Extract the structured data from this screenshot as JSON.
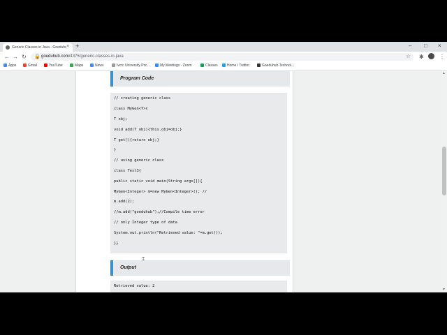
{
  "browser": {
    "tab_title": "Generic Classes in Java - Goeduhub",
    "new_tab": "+",
    "close_tab": "×",
    "window_controls": [
      "–",
      "□",
      "×"
    ],
    "url_host": "goeduhub.com",
    "url_path": "/4375/generic-classes-in-java",
    "bookmarks": [
      {
        "label": "Apps",
        "color": "#4285f4"
      },
      {
        "label": "Gmail",
        "color": "#ea4335"
      },
      {
        "label": "YouTube",
        "color": "#ff0000"
      },
      {
        "label": "Maps",
        "color": "#34a853"
      },
      {
        "label": "News",
        "color": "#4285f4"
      },
      {
        "label": "Ivcrc University Por...",
        "color": "#999999"
      },
      {
        "label": "My Meetings - Zoom",
        "color": "#2d8cff"
      },
      {
        "label": "Classes",
        "color": "#0f9d58"
      },
      {
        "label": "Home / Twitter",
        "color": "#1da1f2"
      },
      {
        "label": "Goeduhub Technol...",
        "color": "#333333"
      }
    ]
  },
  "page": {
    "program_heading": "Program Code",
    "code_lines": [
      "// creating generic class",
      "class MyGen<T>{",
      "T obj;",
      "void add(T obj){this.obj=obj;}",
      "T get(){return obj;}",
      "}",
      "// using generic class",
      "class Test3{",
      "public static void main(String args[]){",
      "MyGen<Integer> m=new MyGen<Integer>(); //",
      "m.add(2);",
      "//m.add(\"goeduhub\");//Compile time error",
      "// only Integer type of data",
      "System.out.println(\"Retrieved value: \"+m.get());",
      "}}"
    ],
    "output_heading": "Output",
    "output_text": "Retrieved value: 2"
  },
  "colors": {
    "accent": "#3b8fc8",
    "code_bg": "#e8eaeb",
    "page_bg": "#eef1f0"
  }
}
